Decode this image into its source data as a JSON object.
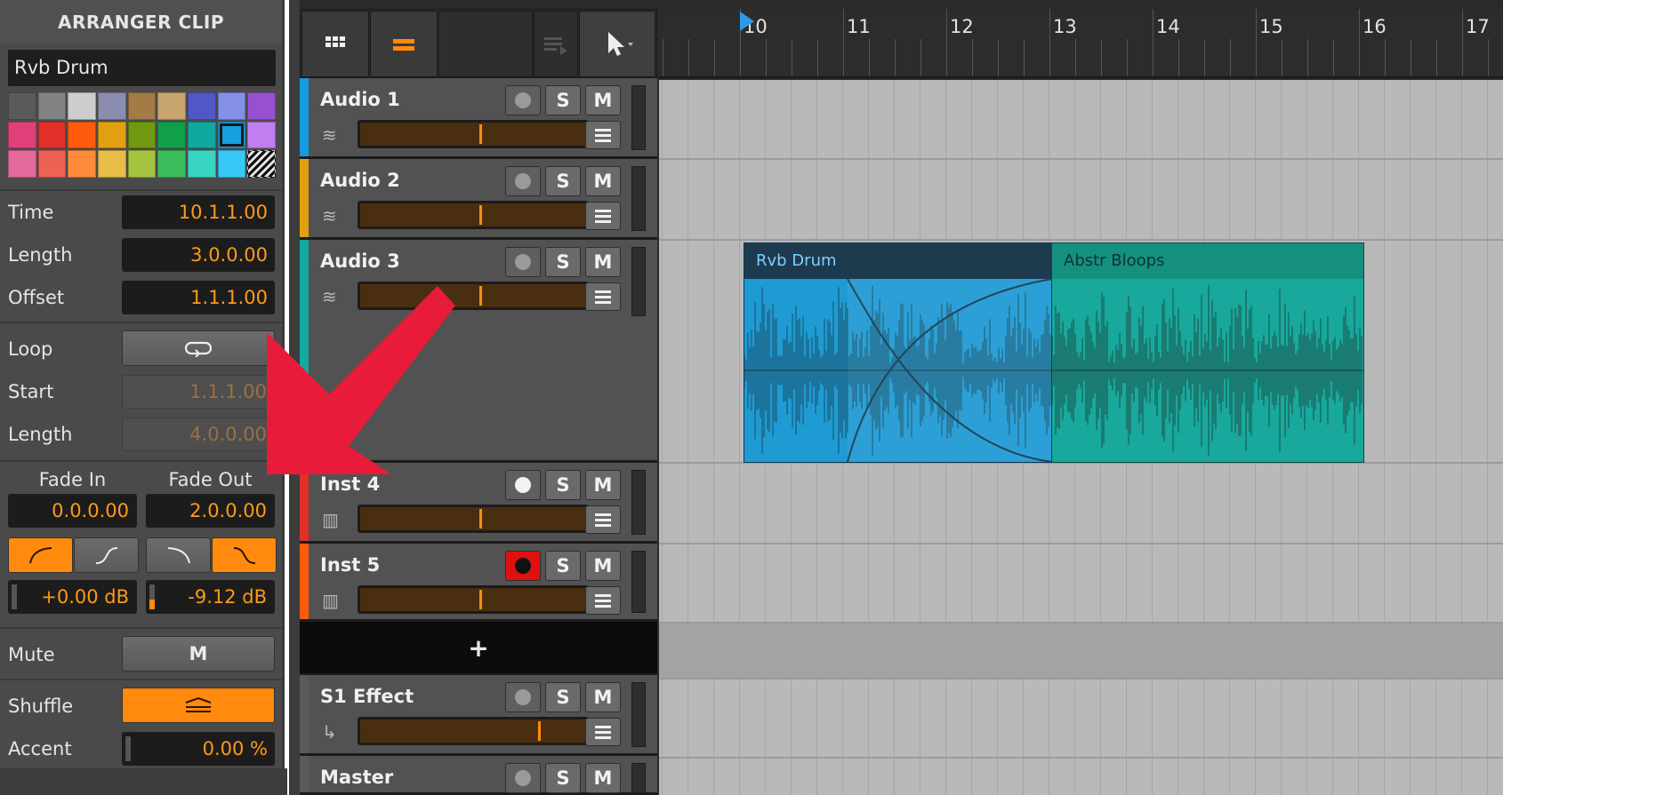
{
  "inspector": {
    "title": "ARRANGER CLIP",
    "clip_name": "Rvb Drum",
    "palette": [
      "#5a5a5a",
      "#838383",
      "#cdcdcd",
      "#8a8db0",
      "#a27b45",
      "#c8a46e",
      "#5058c8",
      "#8490e8",
      "#9650d0",
      "#e0407a",
      "#e03028",
      "#ff5b0c",
      "#e0a010",
      "#6f9a10",
      "#10a048",
      "#10a8a0",
      "#189fdf",
      "#c07ef0",
      "#e46a9c",
      "#ec6255",
      "#ff8a3a",
      "#e8bc48",
      "#a4c440",
      "#3cbe5c",
      "#38d4c0",
      "#38c8f8",
      "hatch"
    ],
    "selected_swatch_index": 16,
    "time_label": "Time",
    "time_value": "10.1.1.00",
    "length_label": "Length",
    "length_value": "3.0.0.00",
    "offset_label": "Offset",
    "offset_value": "1.1.1.00",
    "loop_label": "Loop",
    "start_label": "Start",
    "start_value": "1.1.1.00",
    "loop_length_label": "Length",
    "loop_length_value": "4.0.0.00",
    "fade_in_label": "Fade In",
    "fade_in_value": "0.0.0.00",
    "fade_out_label": "Fade Out",
    "fade_out_value": "2.0.0.00",
    "fade_in_gain": "+0.00 dB",
    "fade_out_gain": "-9.12 dB",
    "mute_label": "Mute",
    "mute_button": "M",
    "shuffle_label": "Shuffle",
    "accent_label": "Accent",
    "accent_value": "0.00 %"
  },
  "ruler": {
    "bars": [
      "10",
      "11",
      "12",
      "13",
      "14",
      "15",
      "16",
      "17"
    ]
  },
  "tracks": [
    {
      "name": "Audio 1",
      "color": "#159be0",
      "type": "audio",
      "armed": false
    },
    {
      "name": "Audio 2",
      "color": "#e0a010",
      "type": "audio",
      "armed": false
    },
    {
      "name": "Audio 3",
      "color": "#10a8a0",
      "type": "audio",
      "armed": false
    },
    {
      "name": "Inst 4",
      "color": "#e03028",
      "type": "instrument",
      "armed": false
    },
    {
      "name": "Inst 5",
      "color": "#ff5b0c",
      "type": "instrument",
      "armed": true
    },
    {
      "name": "S1 Effect",
      "color": "#5a5a5a",
      "type": "effect",
      "armed": false
    },
    {
      "name": "Master",
      "color": "#5a5a5a",
      "type": "master",
      "armed": false
    }
  ],
  "track_buttons": {
    "solo": "S",
    "mute": "M"
  },
  "add_track": "+",
  "clips": [
    {
      "name": "Rvb Drum",
      "color": "#1f9bd4",
      "head": "#1e3a4e",
      "text": "#7ad0ff",
      "selected": true
    },
    {
      "name": "Abstr Bloops",
      "color": "#18a89c",
      "head": "#15907f",
      "text": "#0e3430",
      "selected": false
    }
  ],
  "annotation": {
    "color": "#e81c3a"
  }
}
